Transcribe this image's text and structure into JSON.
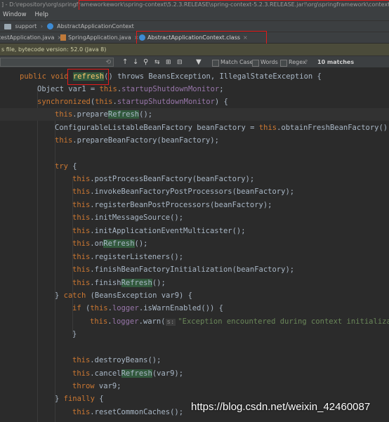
{
  "title_bar": {
    "prefix": "] - D:\\repository\\org\\springframework",
    "path_highlighted": "ework\\spring-context\\5.2.3.RELEASE\\spring-context-5.2.3.RELEASE.jar!\\org\\springframework\\context\\support\\AbstractApplic"
  },
  "menu": [
    "Window",
    "Help"
  ],
  "breadcrumb": [
    "support",
    "AbstractApplicationContext"
  ],
  "tabs": [
    {
      "label": "testApplication.java"
    },
    {
      "label": "SpringApplication.java"
    },
    {
      "label": "AbstractApplicationContext.class"
    }
  ],
  "info_bar": {
    "text": "s file, bytecode version: 52.0 (Java 8)"
  },
  "find_bar": {
    "options": [
      "Match Case",
      "Words",
      "Regex"
    ],
    "help": "?",
    "result": "10 matches"
  },
  "code": {
    "l1": {
      "a": "public void ",
      "b": "refresh",
      "c": "() throws BeansException, IllegalStateException {"
    },
    "l2": {
      "a": "Object var1 = ",
      "b": "this",
      "c": ".",
      "d": "startupShutdownMonitor",
      "e": ";"
    },
    "l3": {
      "a": "synchronized",
      "b": "(",
      "c": "this",
      "d": ".",
      "e": "startupShutdownMonitor",
      "f": ") {"
    },
    "l4": {
      "a": "this",
      "b": ".prepare",
      "c": "Refresh",
      "d": "();"
    },
    "l5": {
      "a": "ConfigurableListableBeanFactory beanFactory = ",
      "b": "this",
      "c": ".obtainFreshBeanFactory();"
    },
    "l6": {
      "a": "this",
      "b": ".prepareBeanFactory(beanFactory);"
    },
    "l8": {
      "a": "try",
      "b": " {"
    },
    "l9": {
      "a": "this",
      "b": ".postProcessBeanFactory(beanFactory);"
    },
    "l10": {
      "a": "this",
      "b": ".invokeBeanFactoryPostProcessors(beanFactory);"
    },
    "l11": {
      "a": "this",
      "b": ".registerBeanPostProcessors(beanFactory);"
    },
    "l12": {
      "a": "this",
      "b": ".initMessageSource();"
    },
    "l13": {
      "a": "this",
      "b": ".initApplicationEventMulticaster();"
    },
    "l14": {
      "a": "this",
      "b": ".on",
      "c": "Refresh",
      "d": "();"
    },
    "l15": {
      "a": "this",
      "b": ".registerListeners();"
    },
    "l16": {
      "a": "this",
      "b": ".finishBeanFactoryInitialization(beanFactory);"
    },
    "l17": {
      "a": "this",
      "b": ".finish",
      "c": "Refresh",
      "d": "();"
    },
    "l18": {
      "a": "} ",
      "b": "catch",
      "c": " (BeansException var9) {"
    },
    "l19": {
      "a": "if",
      "b": " (",
      "c": "this",
      "d": ".",
      "e": "logger",
      "f": ".isWarnEnabled()) {"
    },
    "l20": {
      "a": "this",
      "b": ".",
      "c": "logger",
      "d": ".warn(",
      "e": "s:",
      "f": "\"Exception encountered during context initializat"
    },
    "l21": {
      "a": "}"
    },
    "l23": {
      "a": "this",
      "b": ".destroyBeans();"
    },
    "l24": {
      "a": "this",
      "b": ".cancel",
      "c": "Refresh",
      "d": "(var9);"
    },
    "l25": {
      "a": "throw",
      "b": " var9;"
    },
    "l26": {
      "a": "} ",
      "b": "finally",
      "c": " {"
    },
    "l27": {
      "a": "this",
      "b": ".resetCommonCaches();"
    }
  },
  "watermark": "https://blog.csdn.net/weixin_42460087",
  "colors": {
    "keyword": "#cc7832",
    "method": "#ffc66d",
    "string": "#6a8759",
    "field": "#9876aa",
    "annotation_box": "#e31b1b",
    "match_highlight": "#32593d"
  }
}
